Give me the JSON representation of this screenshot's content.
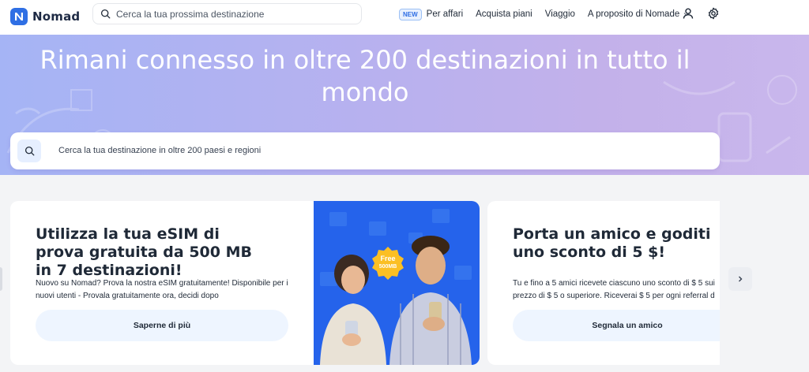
{
  "app": {
    "name": "Nomad"
  },
  "header": {
    "search_placeholder": "Cerca la tua prossima destinazione",
    "new_badge": "NEW",
    "nav": {
      "business": "Per affari",
      "buy_plans": "Acquista piani",
      "travel": "Viaggio",
      "about": "A proposito di Nomade"
    },
    "icons": [
      "search-icon",
      "chevron-down-icon",
      "user-icon",
      "gear-icon"
    ]
  },
  "hero": {
    "title": "Rimani connesso in oltre 200 destinazioni in tutto il mondo",
    "search_placeholder": "Cerca la tua destinazione in oltre 200 paesi e regioni"
  },
  "cards": [
    {
      "title": "Utilizza la tua eSIM di prova gratuita da 500 MB in 7 destinazioni!",
      "description": "Nuovo su Nomad? Prova la nostra eSIM gratuitamente! Disponibile per i nuovi utenti - Provala gratuitamente ora, decidi dopo",
      "cta": "Saperne di più",
      "image_badge_line1": "Free",
      "image_badge_line2": "500MB"
    },
    {
      "title": "Porta un amico e goditi uno sconto di 5 $!",
      "description_line1": "Tu e fino a 5 amici ricevete ciascuno uno sconto di $ 5 sui",
      "description_line2": "prezzo di $ 5 o superiore. Riceverai $ 5 per ogni referral d",
      "cta": "Segnala un amico"
    }
  ],
  "colors": {
    "brand": "#2f6fe4",
    "hero_start": "#a5b4f5",
    "hero_end": "#c9b7ec",
    "cta_bg": "#eef5ff",
    "promo_bg": "#2563eb",
    "badge_yellow": "#fbbf24"
  }
}
